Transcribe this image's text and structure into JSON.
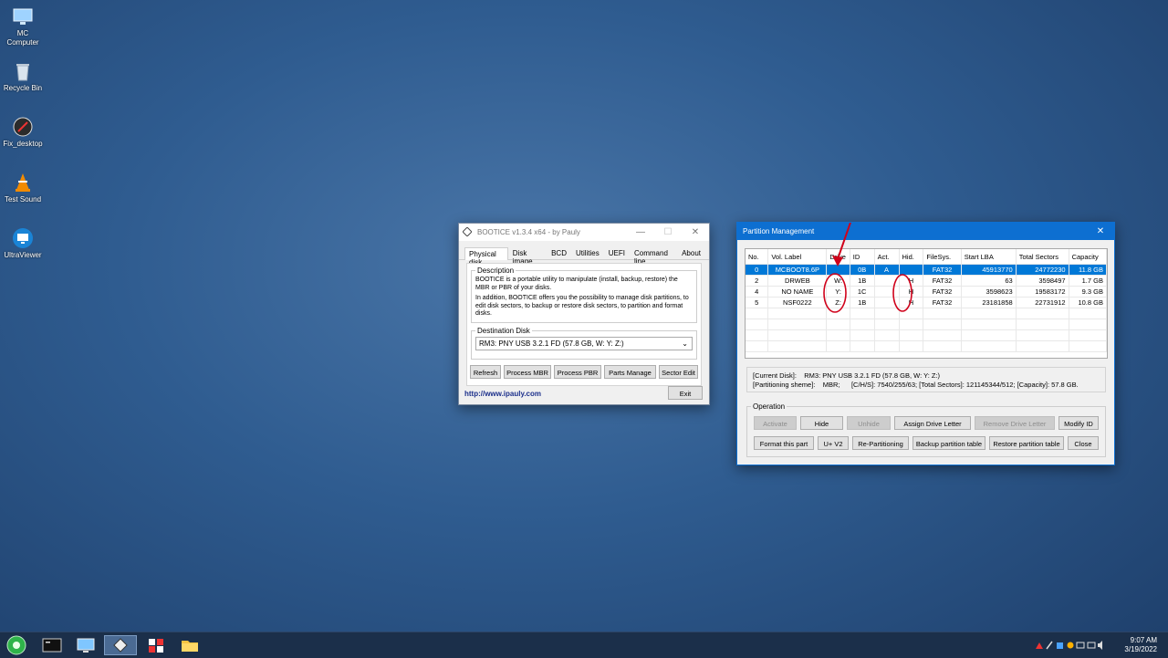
{
  "desktop": {
    "icons": [
      {
        "label": "MC\nComputer",
        "icon": "computer-icon"
      },
      {
        "label": "Recycle Bin",
        "icon": "recycle-bin-icon"
      },
      {
        "label": "Fix_desktop",
        "icon": "fix-desktop-icon"
      },
      {
        "label": "Test Sound",
        "icon": "vlc-cone-icon"
      },
      {
        "label": "UltraViewer",
        "icon": "ultraviewer-icon"
      }
    ]
  },
  "bootice": {
    "title": "BOOTICE v1.3.4 x64 - by Pauly",
    "tabs": [
      "Physical disk",
      "Disk image",
      "BCD",
      "Utilities",
      "UEFI",
      "Command line",
      "About"
    ],
    "description_legend": "Description",
    "description_p1": "BOOTICE is a portable utility to manipulate (install, backup, restore) the MBR or PBR of your disks.",
    "description_p2": "In addition, BOOTICE offers you the possibility to manage disk partitions, to edit disk sectors, to backup or restore disk sectors, to partition and format disks.",
    "destination_legend": "Destination Disk",
    "destination_value": "RM3: PNY USB 3.2.1 FD (57.8 GB, W: Y: Z:)",
    "buttons": [
      "Refresh",
      "Process MBR",
      "Process PBR",
      "Parts Manage",
      "Sector Edit"
    ],
    "link": "http://www.ipauly.com",
    "exit": "Exit"
  },
  "partition": {
    "title": "Partition Management",
    "close_glyph": "✕",
    "columns": [
      "No.",
      "Vol. Label",
      "Drive",
      "ID",
      "Act.",
      "Hid.",
      "FileSys.",
      "Start LBA",
      "Total Sectors",
      "Capacity"
    ],
    "rows": [
      {
        "no": "0",
        "label": "MCBOOT8.6P",
        "drive": "",
        "id": "0B",
        "act": "A",
        "hid": "",
        "fs": "FAT32",
        "start": "45913770",
        "total": "24772230",
        "cap": "11.8 GB",
        "selected": true
      },
      {
        "no": "2",
        "label": "DRWEB",
        "drive": "W:",
        "id": "1B",
        "act": "",
        "hid": "H",
        "fs": "FAT32",
        "start": "63",
        "total": "3598497",
        "cap": "1.7 GB",
        "selected": false
      },
      {
        "no": "4",
        "label": "NO NAME",
        "drive": "Y:",
        "id": "1C",
        "act": "",
        "hid": "H",
        "fs": "FAT32",
        "start": "3598623",
        "total": "19583172",
        "cap": "9.3 GB",
        "selected": false
      },
      {
        "no": "5",
        "label": "NSF0222",
        "drive": "Z:",
        "id": "1B",
        "act": "",
        "hid": "H",
        "fs": "FAT32",
        "start": "23181858",
        "total": "22731912",
        "cap": "10.8 GB",
        "selected": false
      }
    ],
    "info_line1": "[Current Disk]:    RM3: PNY USB 3.2.1 FD (57.8 GB, W: Y: Z:)",
    "info_line2": "[Partitioning sheme]:    MBR;      [C/H/S]: 7540/255/63; [Total Sectors]: 121145344/512; [Capacity]: 57.8 GB.",
    "operation_legend": "Operation",
    "buttons_row1": [
      {
        "label": "Activate",
        "enabled": false
      },
      {
        "label": "Hide",
        "enabled": true
      },
      {
        "label": "Unhide",
        "enabled": false
      },
      {
        "label": "Assign Drive Letter",
        "enabled": true
      },
      {
        "label": "Remove Drive Letter",
        "enabled": false
      },
      {
        "label": "Modify ID",
        "enabled": true
      }
    ],
    "buttons_row2": [
      "Format this part",
      "U+ V2",
      "Re-Partitioning",
      "Backup partition table",
      "Restore partition table",
      "Close"
    ]
  },
  "taskbar": {
    "time": "9:07 AM",
    "date": "3/19/2022"
  },
  "colors": {
    "selection": "#0078d7",
    "annotation": "#d0021b",
    "titlebar_blue": "#0d6fd1"
  }
}
